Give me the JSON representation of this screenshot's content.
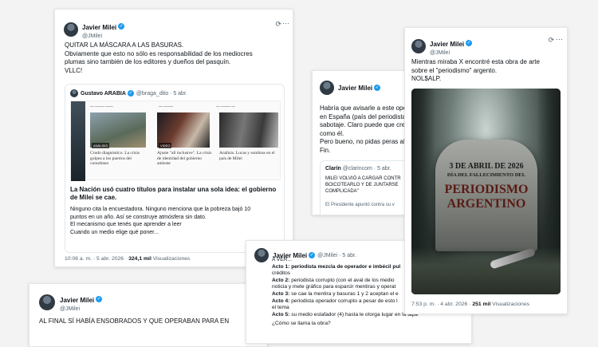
{
  "card1": {
    "author": "Javier Milei",
    "handle": "@JMilei",
    "lines": [
      "QUITAR LA MÁSCARA A LAS BASURAS.",
      "Obviamente que esto no sólo es responsabilidad de los mediocres",
      "plumas sino también de los editores y dueños del pasquín.",
      "VLLC!"
    ],
    "quote": {
      "author": "Gustavo ARABIA",
      "handle": "@braga_dito · 5 abr.",
      "articles": [
        "Crudo diagnóstico. La crisis golpea a los puertos del conurbano",
        "Ajuste \"all inclusive\". La crisis de identidad del gobierno antieste",
        "Análisis. Lucas y sombras en el país de Milei"
      ],
      "chips": [
        "ANÁLISIS",
        "VIDEO"
      ],
      "headline": "La Nación usó cuatro títulos para instalar una sola idea: el gobierno de Milei se cae.",
      "body": [
        "Ninguno cita la encuestadora. Ninguno menciona que la pobreza bajó 10",
        "puntos en un año. Así se construye atmósfera sin dato.",
        "El mecanismo que tenés que aprender a leer",
        "Cuando un medio elige qué poner..."
      ]
    },
    "time": "10:06 a. m. · 5 abr. 2026 ·",
    "views": "324,1 mil",
    "views_label": "Visualizaciones"
  },
  "card2": {
    "author": "Javier Milei",
    "lines": [
      "Habría que avisarle a este oper",
      "en España (país del periodista",
      "sabotaje. Claro puede que crea",
      "como él.",
      "Pero bueno, no pidas peras al",
      "Fin."
    ],
    "quote_source": "Clarín",
    "quote_handle": "@clarincom · 5 abr.",
    "quote_lines": [
      "MILEI VOLVIÓ A CARGAR CONTR",
      "BOICOTEARLO Y DE JUNTARSE",
      "COMPLICADA\""
    ],
    "quote_tail": "El Presidente apuntó contra su v"
  },
  "card3": {
    "author": "Javier Milei",
    "handle": "@JMilei",
    "lines": [
      "Mientras miraba X encontré esta obra de arte",
      "sobre el \"periodismo\" argento.",
      "NOL$ALP."
    ],
    "tomb": [
      "3 DE ABRIL DE 2026",
      "DÍA DEL FALLECIMIENTO DEL",
      "PERIODISMO",
      "ARGENTINO"
    ],
    "time": "7:53 p. m. · 4 abr. 2026 ·",
    "views": "251 mil",
    "views_label": "Visualizaciones"
  },
  "card4": {
    "author": "Javier Milei",
    "handle": "@JMilei · 5 abr.",
    "intro": "A VER...",
    "acts": [
      {
        "label": "Acto 1:",
        "text": "periodista mezcla de operador e imbécil pul"
      },
      {
        "label": "",
        "text": "créditos"
      },
      {
        "label": "Acto 2:",
        "text": "periodista corrupto (con el aval de los medio"
      },
      {
        "label": "",
        "text": "noticia y mete gráfico para esparcir mentiras y operat"
      },
      {
        "label": "Acto 3:",
        "text": "se cae la mentira y basuras 1 y 2 aceptan el e"
      },
      {
        "label": "Acto 4:",
        "text": "periodista operador corrupto a pesar de esto l"
      },
      {
        "label": "",
        "text": "el tema"
      },
      {
        "label": "Acto 5:",
        "text": "su medio estafador (4) hasta le otorga lugar en la tapa"
      }
    ],
    "outro": "¿Cómo se llama la obra?"
  },
  "card5": {
    "author": "Javier Milei",
    "handle": "@JMilei",
    "text": "AL FINAL SÍ HABÍA ENSOBRADOS Y QUE OPERABAN PARA EN"
  },
  "colors": {
    "verified": "#1d9bf0",
    "muted": "#536471"
  }
}
